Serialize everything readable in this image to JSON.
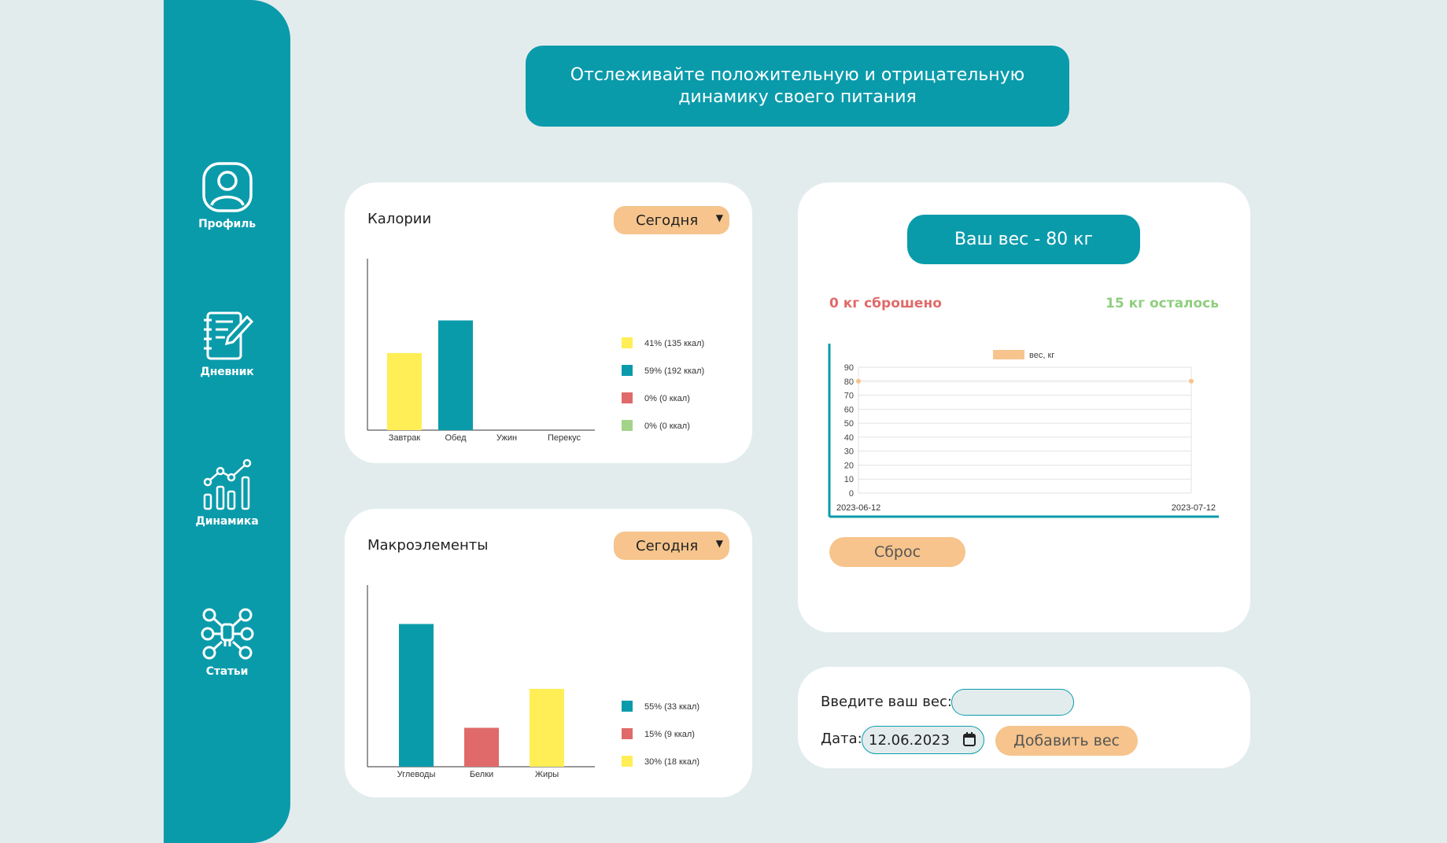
{
  "sidebar": {
    "items": [
      {
        "label": "Профиль",
        "icon": "profile-icon"
      },
      {
        "label": "Дневник",
        "icon": "diary-icon"
      },
      {
        "label": "Динамика",
        "icon": "dynamics-icon"
      },
      {
        "label": "Статьи",
        "icon": "articles-icon"
      }
    ]
  },
  "banner": {
    "text": "Отслеживайте положительную и отрицательную динамику своего питания"
  },
  "calories": {
    "title": "Калории",
    "period": "Сегодня"
  },
  "macros": {
    "title": "Макроэлементы",
    "period": "Сегодня"
  },
  "weight": {
    "current": "Ваш вес - 80 кг",
    "lost": "0 кг сброшено",
    "remaining": "15 кг осталось",
    "reset_label": "Сброс"
  },
  "add_weight": {
    "weight_label": "Введите ваш вес:",
    "weight_value": "",
    "date_label": "Дата:",
    "date_value": "12.06.2023",
    "submit_label": "Добавить вес"
  },
  "colors": {
    "accent": "#0a9bab",
    "orange": "#f6c48c",
    "yellow": "#ffee55",
    "red": "#e06a6a",
    "green": "#a3d48a"
  },
  "chart_data": [
    {
      "type": "bar",
      "title": "Калории",
      "categories": [
        "Завтрак",
        "Обед",
        "Ужин",
        "Перекус"
      ],
      "values": [
        135,
        192,
        0,
        0
      ],
      "colors": [
        "#ffee55",
        "#0a9bab",
        "#e06a6a",
        "#a3d48a"
      ],
      "legend": [
        "41% (135 ккал)",
        "59% (192 ккал)",
        "0% (0 ккал)",
        "0% (0 ккал)"
      ],
      "ylim": [
        0,
        300
      ],
      "legend_position": "right"
    },
    {
      "type": "bar",
      "title": "Макроэлементы",
      "categories": [
        "Углеводы",
        "Белки",
        "Жиры"
      ],
      "values": [
        33,
        9,
        18
      ],
      "colors": [
        "#0a9bab",
        "#e06a6a",
        "#ffee55"
      ],
      "legend": [
        "55% (33 ккал)",
        "15% (9 ккал)",
        "30% (18 ккал)"
      ],
      "ylim": [
        0,
        42
      ],
      "legend_position": "right"
    },
    {
      "type": "line",
      "series": [
        {
          "name": "вес, кг",
          "x": [
            "2023-06-12",
            "2023-07-12"
          ],
          "values": [
            80,
            80
          ]
        }
      ],
      "yticks": [
        0,
        10,
        20,
        30,
        40,
        50,
        60,
        70,
        80,
        90
      ],
      "ylim": [
        0,
        90
      ],
      "xlabels": [
        "2023-06-12",
        "2023-07-12"
      ],
      "grid": true,
      "legend_position": "top"
    }
  ]
}
